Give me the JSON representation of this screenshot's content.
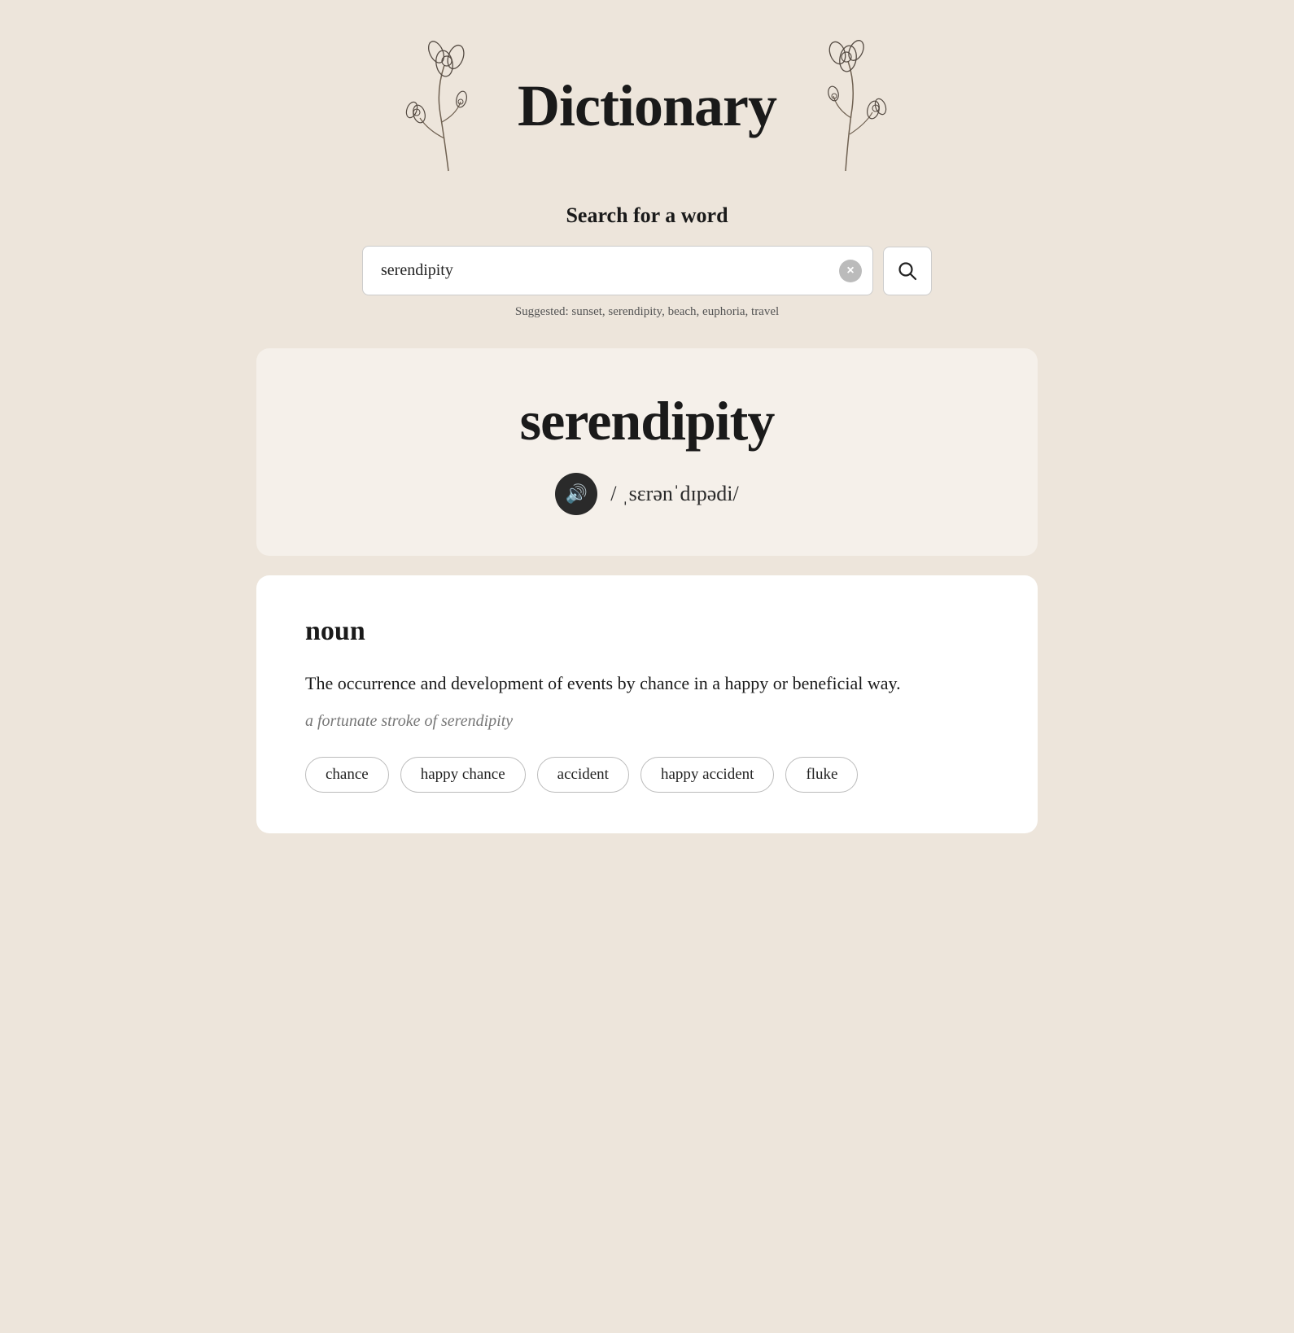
{
  "header": {
    "title": "Dictionary"
  },
  "search": {
    "label": "Search for a word",
    "value": "serendipity",
    "clear_label": "×",
    "search_label": "🔍",
    "suggestions_label": "Suggested: sunset, serendipity, beach, euphoria, travel"
  },
  "word_card": {
    "word": "serendipity",
    "pronunciation": "/ ˌsɛrənˈdɪpədi/",
    "audio_label": "🔊"
  },
  "definition_card": {
    "pos": "noun",
    "definition": "The occurrence and development of events by chance in a happy or beneficial way.",
    "example": "a fortunate stroke of serendipity",
    "synonyms": [
      "chance",
      "happy chance",
      "accident",
      "happy accident",
      "fluke"
    ]
  }
}
